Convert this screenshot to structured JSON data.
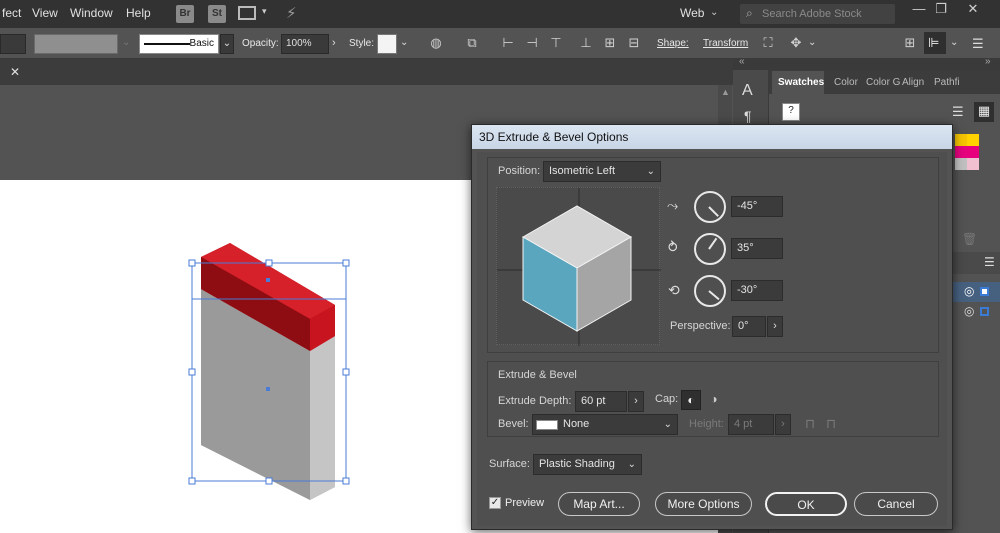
{
  "menubar": {
    "items": [
      "fect",
      "View",
      "Window",
      "Help"
    ],
    "app_icons": [
      "Br",
      "St"
    ],
    "workspace": "Web",
    "search_placeholder": "Search Adobe Stock"
  },
  "controlbar": {
    "stroke_profile": "Basic",
    "opacity_label": "Opacity:",
    "opacity_value": "100%",
    "style_label": "Style:",
    "shape_label": "Shape:",
    "transform_label": "Transform"
  },
  "panels": {
    "tabs": [
      "Swatches",
      "Color",
      "Color G",
      "Align",
      "Pathfi"
    ],
    "swatch_colors": [
      "#f5c400",
      "#e6002d",
      "#ffffff",
      "#ffd200"
    ]
  },
  "dialog": {
    "title": "3D Extrude & Bevel Options",
    "position_label": "Position:",
    "position_value": "Isometric Left",
    "rotate_x": "-45°",
    "rotate_y": "35°",
    "rotate_z": "-30°",
    "perspective_label": "Perspective:",
    "perspective_value": "0°",
    "extrude_section": "Extrude & Bevel",
    "extrude_depth_label": "Extrude Depth:",
    "extrude_depth_value": "60 pt",
    "cap_label": "Cap:",
    "bevel_label": "Bevel:",
    "bevel_value": "None",
    "height_label": "Height:",
    "height_value": "4 pt",
    "surface_label": "Surface:",
    "surface_value": "Plastic Shading",
    "preview_label": "Preview",
    "preview_checked": true,
    "buttons": {
      "map_art": "Map Art...",
      "more_options": "More Options",
      "ok": "OK",
      "cancel": "Cancel"
    }
  },
  "colors": {
    "cube_front": "#5ba5bd",
    "cube_top": "#d6d6d6",
    "cube_side": "#a6a6a6",
    "object_red": "#c8141f",
    "object_gray": "#9d9d9d",
    "selection": "#4a7bd6"
  }
}
